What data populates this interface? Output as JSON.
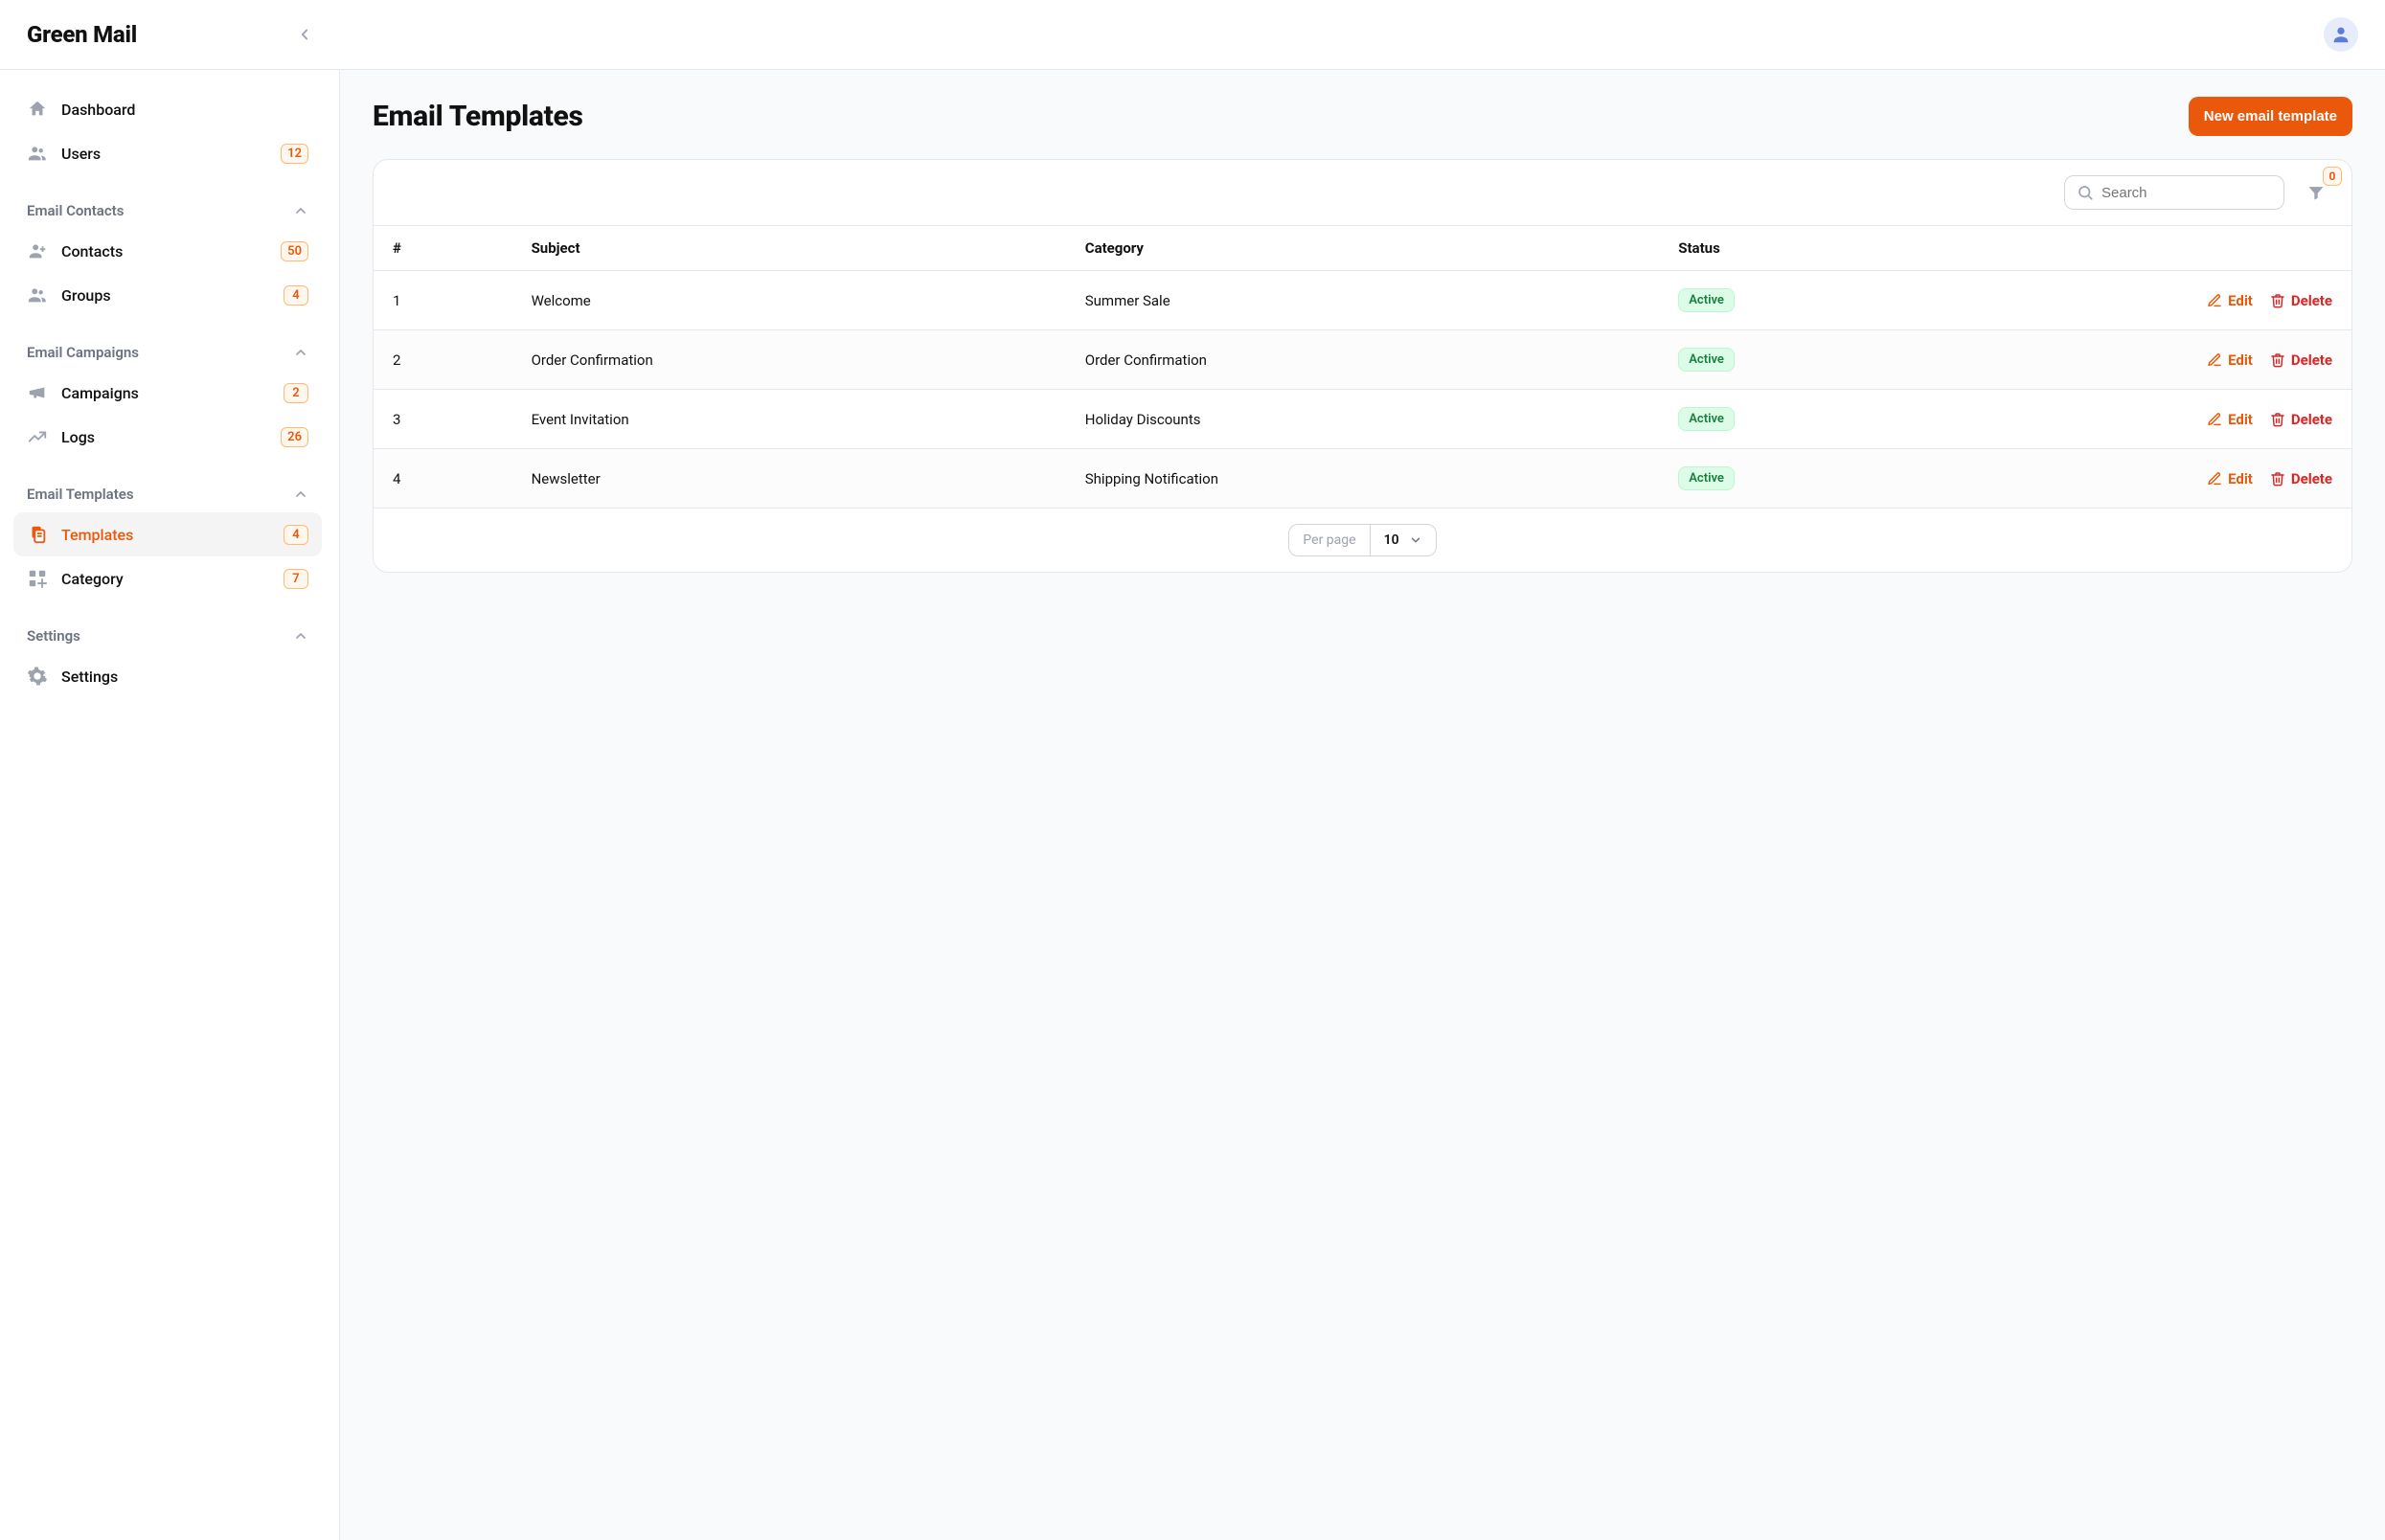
{
  "app": {
    "name": "Green Mail"
  },
  "user": {},
  "sidebar": {
    "top": [
      {
        "id": "dashboard",
        "label": "Dashboard",
        "icon": "home"
      },
      {
        "id": "users",
        "label": "Users",
        "icon": "users",
        "badge": "12"
      }
    ],
    "sections": [
      {
        "id": "contacts",
        "label": "Email Contacts",
        "collapsed": false,
        "items": [
          {
            "id": "contacts",
            "label": "Contacts",
            "icon": "user-plus",
            "badge": "50"
          },
          {
            "id": "groups",
            "label": "Groups",
            "icon": "users",
            "badge": "4"
          }
        ]
      },
      {
        "id": "campaigns",
        "label": "Email Campaigns",
        "collapsed": false,
        "items": [
          {
            "id": "campaigns",
            "label": "Campaigns",
            "icon": "megaphone",
            "badge": "2"
          },
          {
            "id": "logs",
            "label": "Logs",
            "icon": "trend",
            "badge": "26"
          }
        ]
      },
      {
        "id": "templates",
        "label": "Email Templates",
        "collapsed": false,
        "items": [
          {
            "id": "templates",
            "label": "Templates",
            "icon": "doc-copy",
            "badge": "4",
            "active": true
          },
          {
            "id": "category",
            "label": "Category",
            "icon": "grid-add",
            "badge": "7"
          }
        ]
      },
      {
        "id": "settings",
        "label": "Settings",
        "collapsed": false,
        "items": [
          {
            "id": "settings",
            "label": "Settings",
            "icon": "gear"
          }
        ]
      }
    ]
  },
  "page": {
    "title": "Email Templates",
    "primary_action": "New email template",
    "search_placeholder": "Search",
    "filter_count": "0"
  },
  "table": {
    "columns": [
      "#",
      "Subject",
      "Category",
      "Status"
    ],
    "actions": {
      "edit": "Edit",
      "delete": "Delete"
    },
    "rows": [
      {
        "num": "1",
        "subject": "Welcome",
        "category": "Summer Sale",
        "status": "Active"
      },
      {
        "num": "2",
        "subject": "Order Confirmation",
        "category": "Order Confirmation",
        "status": "Active"
      },
      {
        "num": "3",
        "subject": "Event Invitation",
        "category": "Holiday Discounts",
        "status": "Active"
      },
      {
        "num": "4",
        "subject": "Newsletter",
        "category": "Shipping Notification",
        "status": "Active"
      }
    ]
  },
  "pagination": {
    "per_page_label": "Per page",
    "per_page_value": "10"
  },
  "colors": {
    "accent": "#ea580c",
    "danger": "#dc2626",
    "success_bg": "#dcfce7",
    "success_text": "#15803d",
    "badge_border": "#fdba74",
    "badge_bg": "#fff7ed"
  }
}
